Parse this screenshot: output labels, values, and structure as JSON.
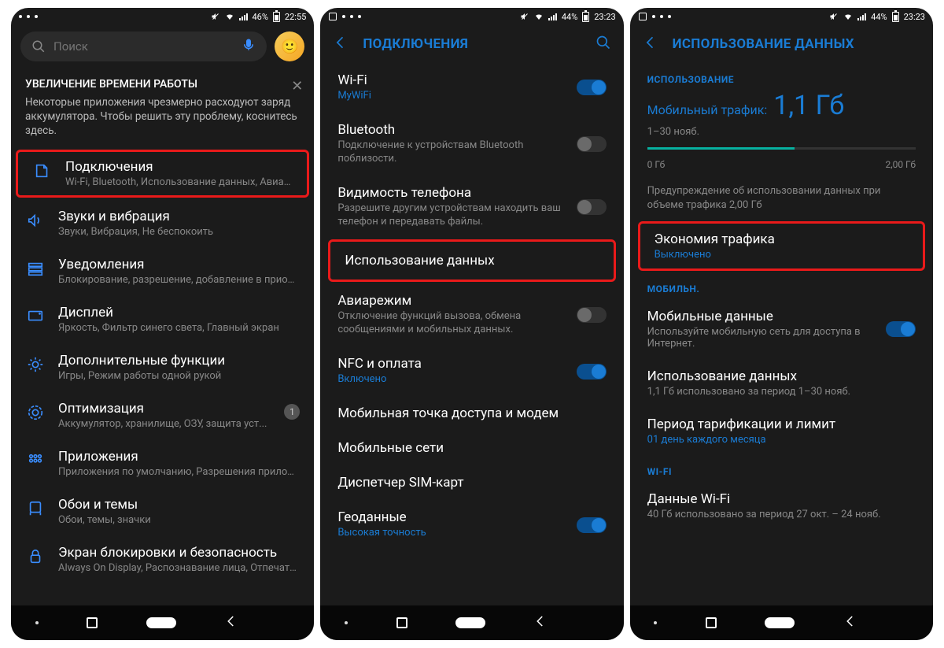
{
  "s1": {
    "status": {
      "battery": "46%",
      "time": "22:55"
    },
    "search": {
      "placeholder": "Поиск"
    },
    "banner": {
      "title": "УВЕЛИЧЕНИЕ ВРЕМЕНИ РАБОТЫ",
      "body": "Некоторые приложения чрезмерно расходуют заряд аккумулятора. Чтобы решить эту проблему, коснитесь здесь."
    },
    "items": [
      {
        "t": "Подключения",
        "s": "Wi-Fi, Bluetooth, Использование данных, Авиареж..."
      },
      {
        "t": "Звуки и вибрация",
        "s": "Звуки, Вибрация, Не беспокоить"
      },
      {
        "t": "Уведомления",
        "s": "Блокирование, разрешение, добавление в приор..."
      },
      {
        "t": "Дисплей",
        "s": "Яркость, Фильтр синего света, Главный экран"
      },
      {
        "t": "Дополнительные функции",
        "s": "Игры, Режим работы одной рукой"
      },
      {
        "t": "Оптимизация",
        "s": "Аккумулятор, хранилище, ОЗУ, защита уст...",
        "badge": "1"
      },
      {
        "t": "Приложения",
        "s": "Приложения по умолчанию, Разрешения прилож..."
      },
      {
        "t": "Обои и темы",
        "s": "Обои, темы, значки"
      },
      {
        "t": "Экран блокировки и безопасность",
        "s": "Always On Display, Распознавание лица, Отпечатк..."
      }
    ]
  },
  "s2": {
    "status": {
      "battery": "44%",
      "time": "23:23"
    },
    "header": "ПОДКЛЮЧЕНИЯ",
    "items": [
      {
        "t": "Wi-Fi",
        "s": "MyWiFi",
        "blue": true,
        "toggle": "on"
      },
      {
        "t": "Bluetooth",
        "s": "Подключение к устройствам Bluetooth поблизости.",
        "toggle": "off"
      },
      {
        "t": "Видимость телефона",
        "s": "Разрешите другим устройствам находить ваш телефон и передавать файлы.",
        "toggle": "off"
      },
      {
        "t": "Использование данных",
        "hl": true
      },
      {
        "t": "Авиарежим",
        "s": "Отключение функций вызова, обмена сообщениями и мобильных данных.",
        "toggle": "off"
      },
      {
        "t": "NFC и оплата",
        "s": "Включено",
        "blue": true,
        "toggle": "on"
      },
      {
        "t": "Мобильная точка доступа и модем"
      },
      {
        "t": "Мобильные сети"
      },
      {
        "t": "Диспетчер SIM-карт"
      },
      {
        "t": "Геоданные",
        "s": "Высокая точность",
        "blue": true,
        "toggle": "on"
      }
    ]
  },
  "s3": {
    "status": {
      "battery": "44%",
      "time": "23:23"
    },
    "header": "ИСПОЛЬЗОВАНИЕ ДАННЫХ",
    "sec_usage": "ИСПОЛЬЗОВАНИЕ",
    "usage": {
      "label": "Мобильный трафик:",
      "value": "1,1 Гб",
      "period": "1–30 нояб."
    },
    "bar": {
      "min": "0 Гб",
      "max": "2,00 Гб",
      "fillPercent": 55
    },
    "warning": "Предупреждение об использовании данных при объеме трафика 2,00 Гб",
    "saver": {
      "t": "Экономия трафика",
      "s": "Выключено"
    },
    "sec_mobile": "МОБИЛЬН.",
    "mobile": [
      {
        "t": "Мобильные данные",
        "s": "Используйте мобильную сеть для доступа в Интернет.",
        "toggle": "on"
      },
      {
        "t": "Использование данных",
        "s": "1,1 Гб использовано за период 1–30 нояб."
      },
      {
        "t": "Период тарификации и лимит",
        "s": "01 день каждого месяца",
        "blue": true
      }
    ],
    "sec_wifi": "WI-FI",
    "wifi": {
      "t": "Данные Wi-Fi",
      "s": "40 Гб использовано за период 27 окт. – 24 нояб."
    }
  }
}
